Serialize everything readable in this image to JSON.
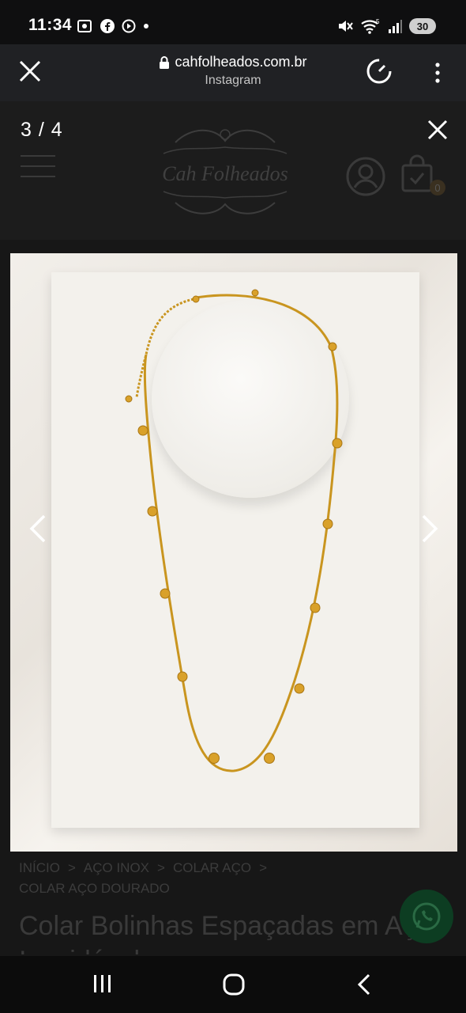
{
  "status_bar": {
    "time": "11:34",
    "battery": "30",
    "left_icons": [
      "screenshot-icon",
      "facebook-icon",
      "play-icon",
      "dot-icon"
    ],
    "right_icons": [
      "mute-icon",
      "wifi-icon",
      "signal-icon"
    ]
  },
  "browser": {
    "domain": "cahfolheados.com.br",
    "source": "Instagram",
    "close_icon": "close-icon",
    "menu_icon": "more-vert-icon"
  },
  "viewer": {
    "counter": "3 / 4",
    "close_icon": "close-icon"
  },
  "site": {
    "logo_text": "Cah Folheados",
    "cart_count": "0"
  },
  "breadcrumb": {
    "items": [
      "INÍCIO",
      "AÇO INOX",
      "COLAR AÇO",
      "COLAR AÇO DOURADO"
    ],
    "separator": ">"
  },
  "product": {
    "title": "Colar Bolinhas Espaçadas em Aço Inoxidável"
  },
  "colors": {
    "gold": "#c9951f",
    "whatsapp": "#25d366"
  }
}
